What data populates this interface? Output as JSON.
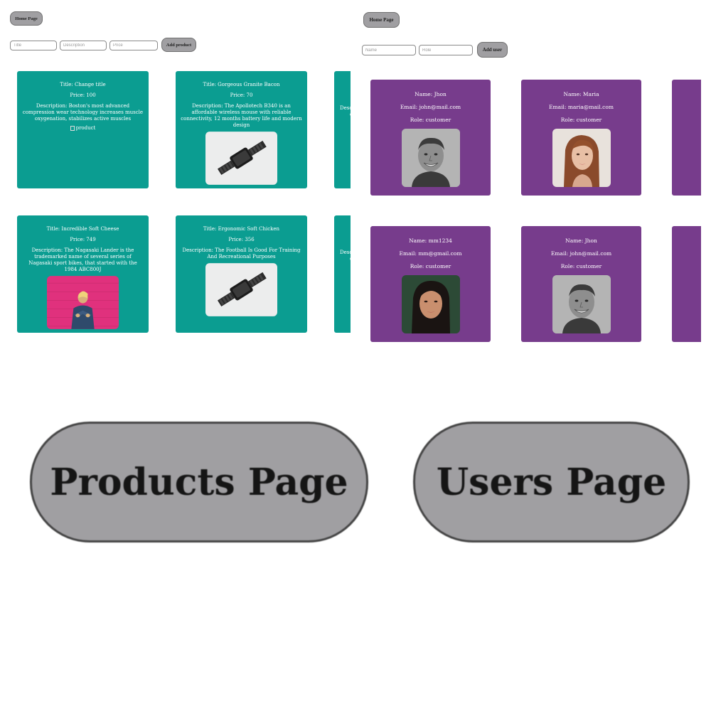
{
  "products_screen": {
    "home_button": "Home Page",
    "form": {
      "title_placeholder": "Title",
      "description_placeholder": "Description",
      "price_placeholder": "Price",
      "add_button": "Add product"
    },
    "products": [
      {
        "title": "Title: Change title",
        "price": "Price: 100",
        "description": "Description: Boston's most advanced compression wear technology increases muscle oxygenation, stabilizes active muscles",
        "image_alt": "product",
        "image": "broken"
      },
      {
        "title": "Title: Gorgeous Granite Bacon",
        "price": "Price: 70",
        "description": "Description: The Apollotech B340 is an affordable wireless mouse with reliable connectivity, 12 months battery life and modern design",
        "image": "smartwatch-photo"
      },
      {
        "title": "Title: Incredible Soft Cheese",
        "price": "Price: 749",
        "description": "Description: The Nagasaki Lander is the trademarked name of several series of Nagasaki sport bikes, that started with the 1984 ABC800J",
        "image": "person-on-pink-wall-photo"
      },
      {
        "title": "Title: Ergonomic Soft Chicken",
        "price": "Price: 356",
        "description": "Description: The Football Is Good For Training And Recreational Purposes",
        "image": "smartwatch-photo"
      }
    ],
    "partial_card_text": [
      "Desc",
      "dur",
      "Desc",
      "dur"
    ]
  },
  "users_screen": {
    "home_button": "Home Page",
    "form": {
      "name_placeholder": "Name",
      "role_placeholder": "Role",
      "add_button": "Add user"
    },
    "users": [
      {
        "name": "Name: Jhon",
        "email": "Email: john@mail.com",
        "role": "Role: customer",
        "avatar": "smiling-man-bw-photo"
      },
      {
        "name": "Name: Maria",
        "email": "Email: maria@mail.com",
        "role": "Role: customer",
        "avatar": "young-woman-photo"
      },
      {
        "name": "Name: mm1234",
        "email": "Email: mm@gmail.com",
        "role": "Role: customer",
        "avatar": "asian-woman-photo"
      },
      {
        "name": "Name: Jhon",
        "email": "Email: john@mail.com",
        "role": "Role: customer",
        "avatar": "smiling-man-bw-photo"
      }
    ]
  },
  "home_screen": {
    "products_button": "Products Page",
    "users_button": "Users Page"
  },
  "colors": {
    "product_card": "#0b9d91",
    "user_card": "#773c8c",
    "button_gray": "#a09fa2"
  }
}
